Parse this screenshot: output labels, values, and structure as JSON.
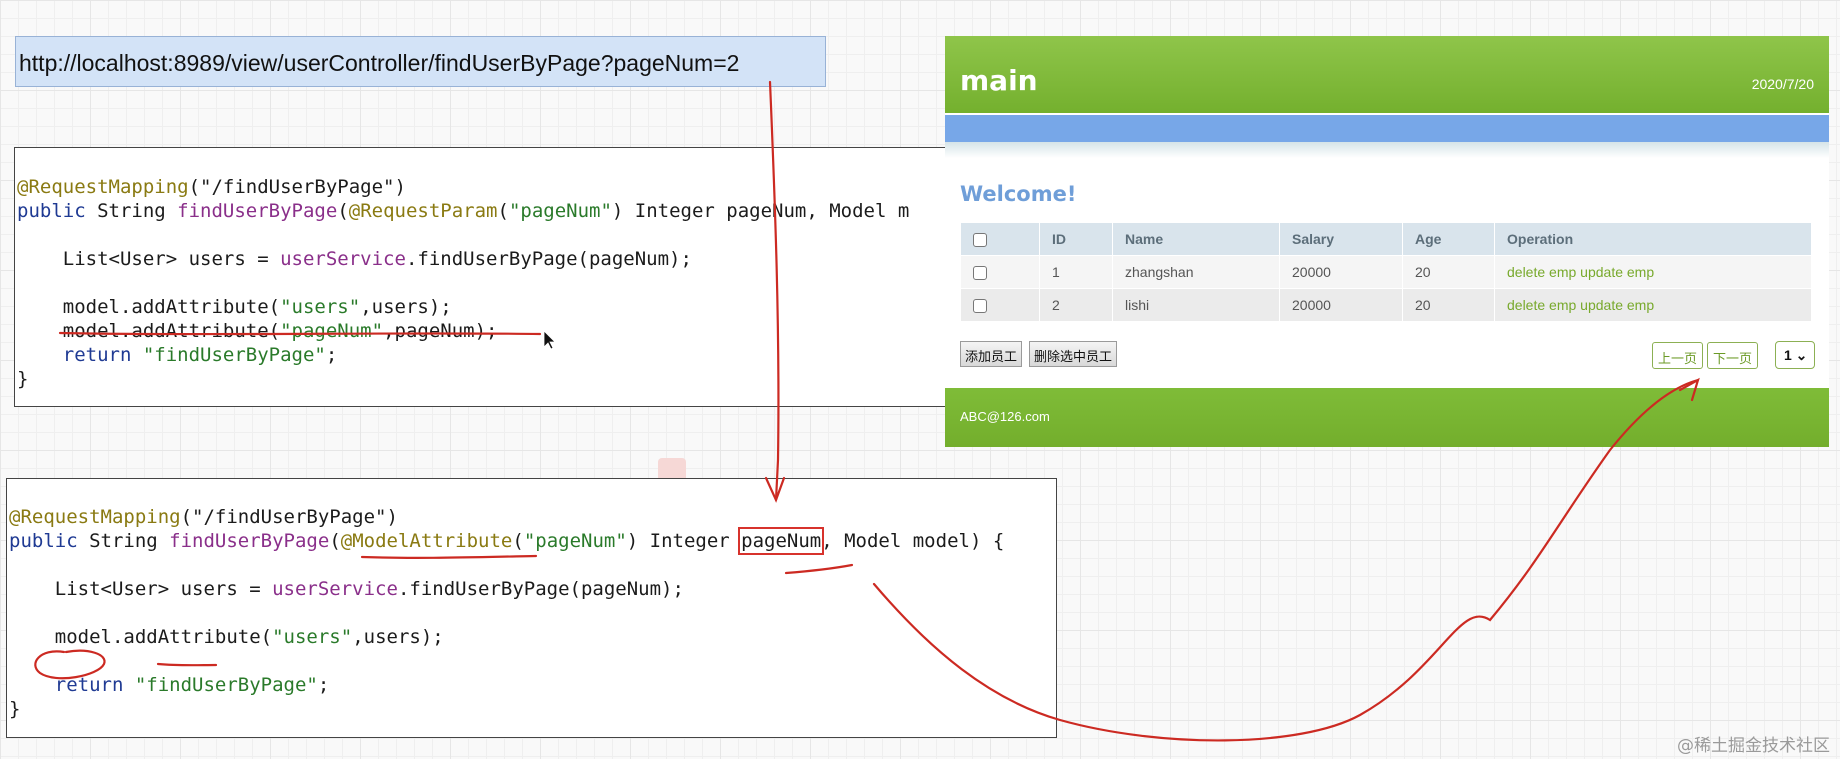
{
  "url_bar": {
    "text": "http://localhost:8989/view/userController/findUserByPage?pageNum=2"
  },
  "code_top": {
    "line1_ann": "@RequestMapping",
    "line1_rest": "(\"/findUserByPage\")",
    "line2_kw": "public",
    "line2_a": " String ",
    "line2_fn": "findUserByPage",
    "line2_b": "(",
    "line2_ann": "@RequestParam",
    "line2_c": "(",
    "line2_str": "\"pageNum\"",
    "line2_d": ") Integer pageNum, Model m",
    "line3_a": "    List<User> users = ",
    "line3_fn": "userService",
    "line3_b": ".findUserByPage(pageNum);",
    "line4_a": "    model.addAttribute(",
    "line4_str": "\"users\"",
    "line4_b": ",users);",
    "line5_a": "    model.addAttribute(",
    "line5_str": "\"pageNum\"",
    "line5_b": ",pageNum);",
    "line6_a": "    ",
    "line6_kw": "return",
    "line6_str": " \"findUserByPage\"",
    "line6_b": ";",
    "line7": "}"
  },
  "code_bottom": {
    "line1_ann": "@RequestMapping",
    "line1_rest": "(\"/findUserByPage\")",
    "line2_kw": "public",
    "line2_a": " String ",
    "line2_fn": "findUserByPage",
    "line2_b": "(",
    "line2_ann": "@ModelAttribute",
    "line2_c": "(",
    "line2_str": "\"pageNum\"",
    "line2_d": ") Integer ",
    "line2_box": "pageNum",
    "line2_e": ", Model model) {",
    "line3_a": "    List<User> users = ",
    "line3_fn": "userService",
    "line3_b": ".findUserByPage(pageNum);",
    "line4_a": "    model.addAttribute(",
    "line4_str": "\"users\"",
    "line4_b": ",users);",
    "line6_a": "    ",
    "line6_kw": "return",
    "line6_str": " \"findUserByPage\"",
    "line6_b": ";",
    "line7": "}"
  },
  "app": {
    "title": "main",
    "date": "2020/7/20",
    "welcome": "Welcome!",
    "columns": [
      "ID",
      "Name",
      "Salary",
      "Age",
      "Operation"
    ],
    "rows": [
      {
        "id": "1",
        "name": "zhangshan",
        "salary": "20000",
        "age": "20",
        "delete": "delete emp",
        "update": "update emp"
      },
      {
        "id": "2",
        "name": "lishi",
        "salary": "20000",
        "age": "20",
        "delete": "delete emp",
        "update": "update emp"
      }
    ],
    "add_button": "添加员工",
    "delete_selected_button": "删除选中员工",
    "prev_button": "上一页",
    "next_button": "下一页",
    "page_select": "1 ⌄",
    "footer_email": "ABC@126.com"
  },
  "watermark": "@稀土掘金技术社区",
  "colors": {
    "header_green": "#7cb737",
    "band_blue": "#77a7e8",
    "annotation_red": "#cc2a22"
  }
}
